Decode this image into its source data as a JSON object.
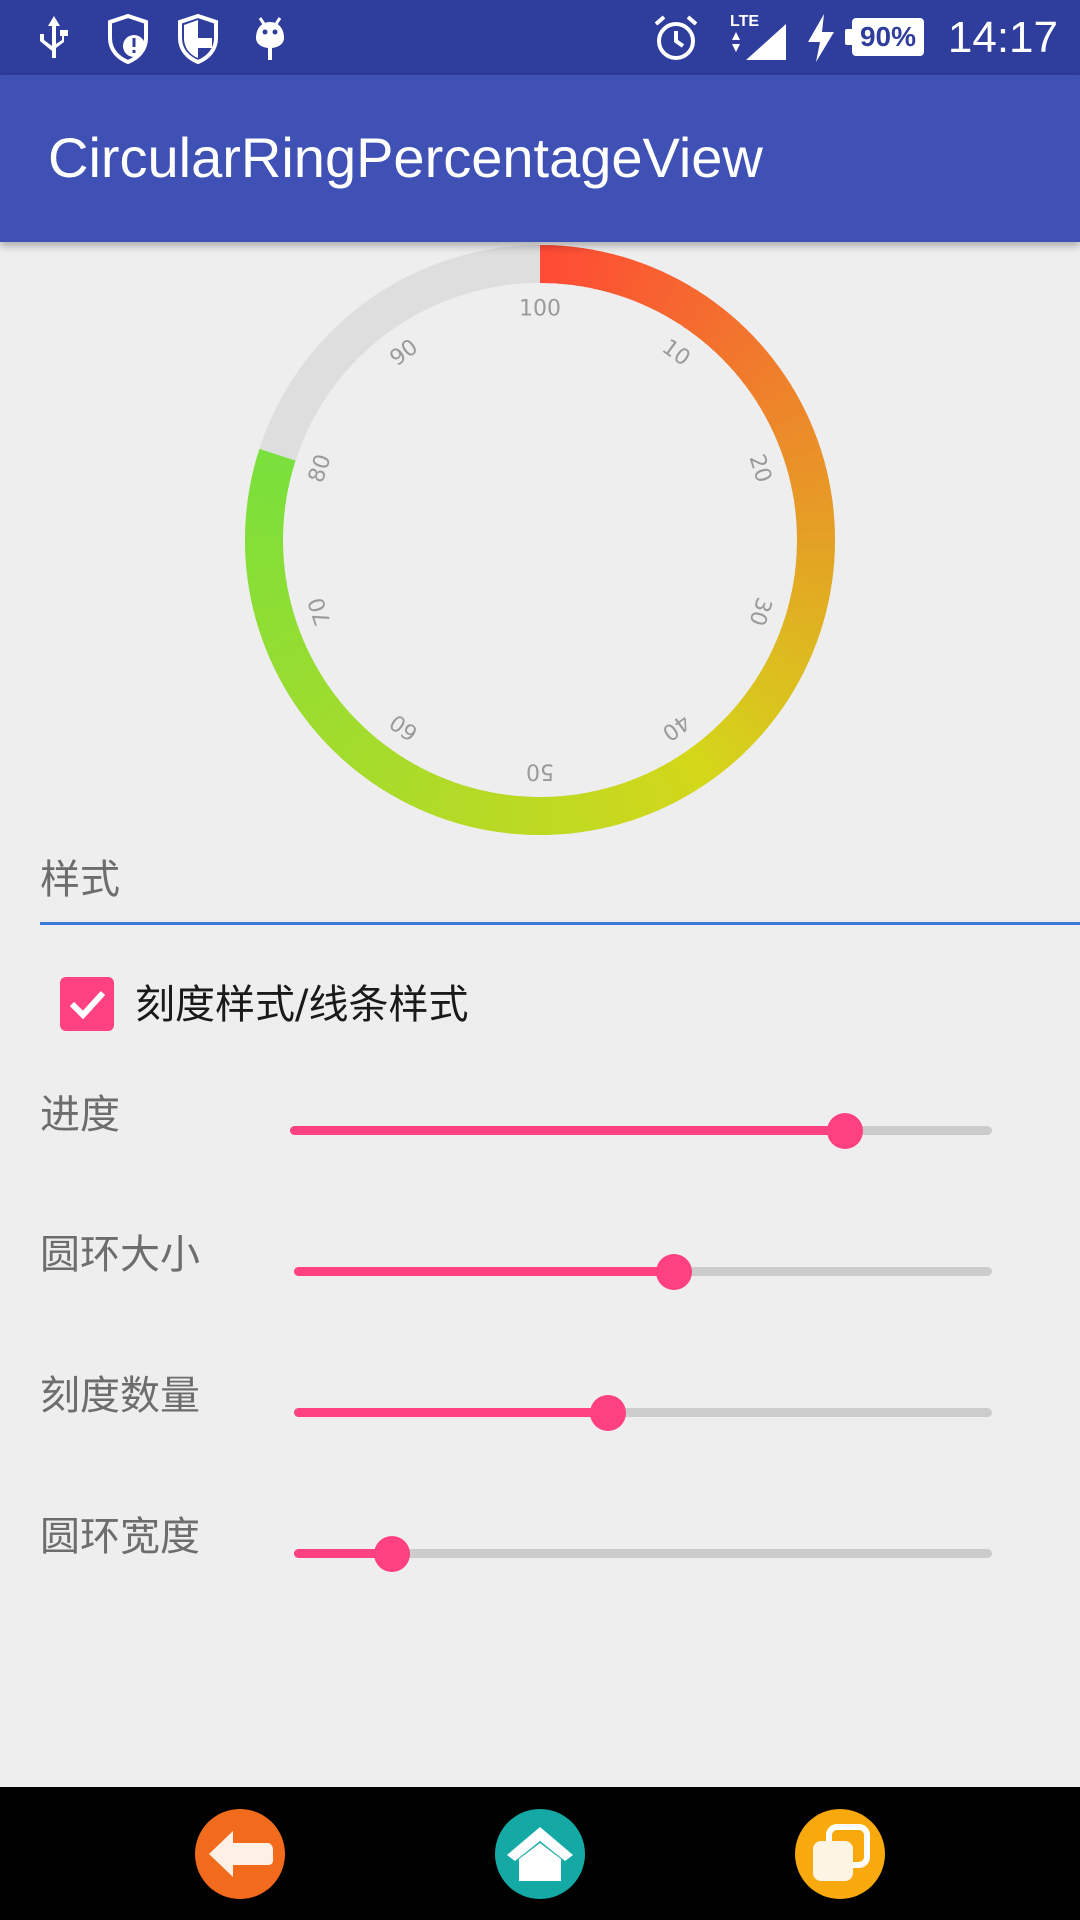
{
  "status_bar": {
    "time": "14:17",
    "battery_percent": "90%",
    "network": "LTE",
    "icons": [
      "usb-icon",
      "shield-alert-icon",
      "shield-icon",
      "android-debug-icon",
      "alarm-icon",
      "lte-signal-icon",
      "charging-icon",
      "battery-icon"
    ]
  },
  "app_bar": {
    "title": "CircularRingPercentageView"
  },
  "ring": {
    "progress_percent": 80,
    "tick_labels": [
      "100",
      "10",
      "20",
      "30",
      "40",
      "50",
      "60",
      "70",
      "80",
      "90"
    ],
    "colors": {
      "start": "#ff4a35",
      "middle": "#d4d71a",
      "end": "#78e03c",
      "track": "#dedede"
    }
  },
  "style_section": {
    "header": "样式",
    "checkbox_label": "刻度样式/线条样式",
    "checkbox_checked": true
  },
  "sliders": [
    {
      "label": "进度",
      "value": 0.79
    },
    {
      "label": "圆环大小",
      "value": 0.545
    },
    {
      "label": "刻度数量",
      "value": 0.45
    },
    {
      "label": "圆环宽度",
      "value": 0.14
    }
  ],
  "accent_color": "#ff4081",
  "nav_bar": {
    "back_icon": "back-arrow-icon",
    "home_icon": "home-icon",
    "recents_icon": "recents-icon"
  }
}
